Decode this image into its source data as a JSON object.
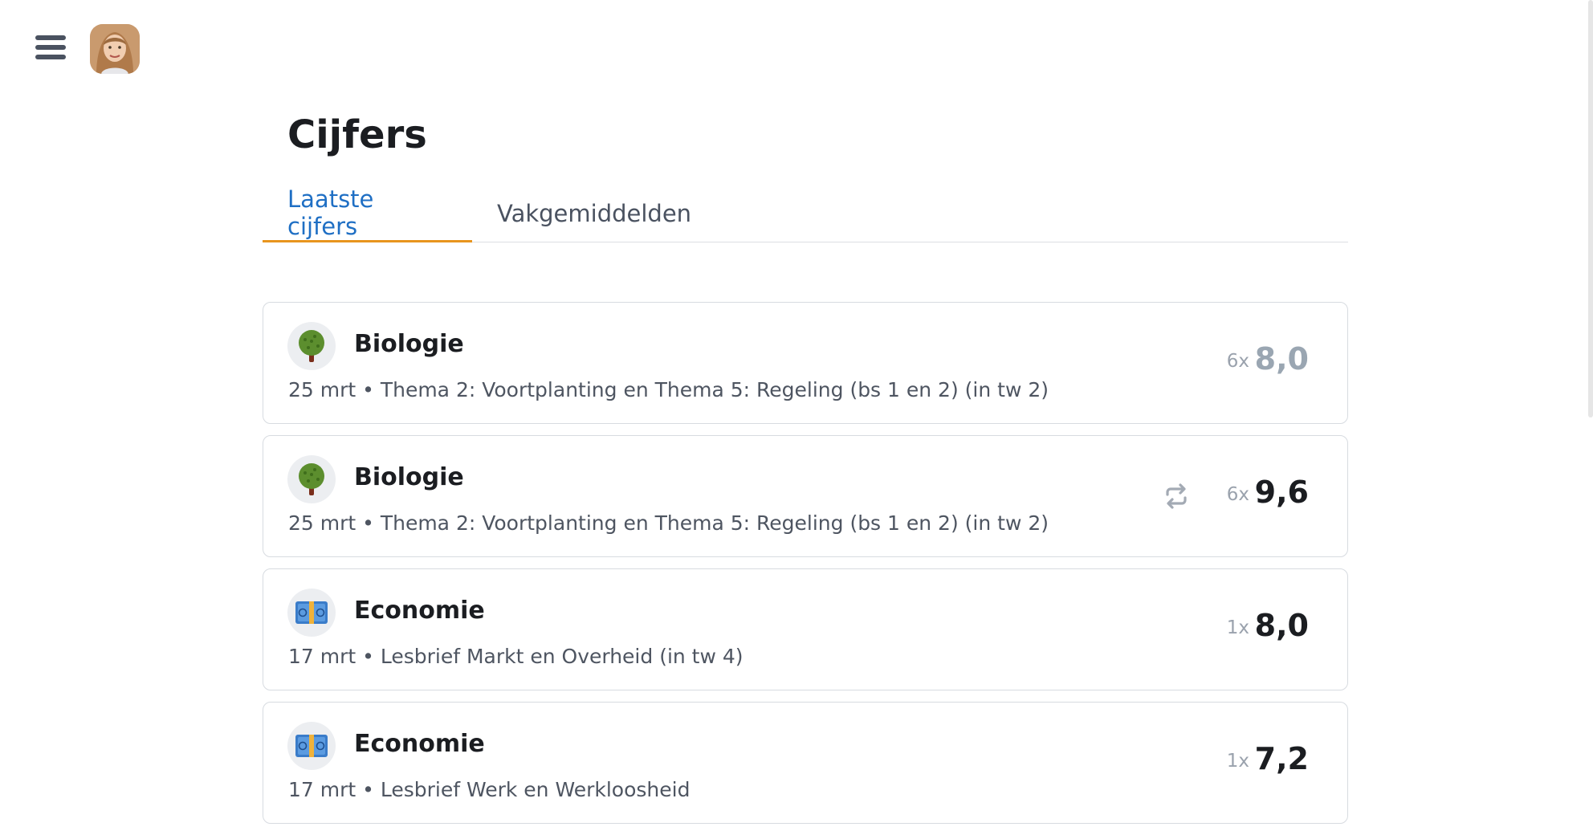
{
  "header": {
    "menu_icon": "hamburger-menu-icon",
    "avatar": "user-avatar"
  },
  "page": {
    "title": "Cijfers"
  },
  "tabs": [
    {
      "label": "Laatste cijfers",
      "active": true
    },
    {
      "label": "Vakgemiddelden",
      "active": false
    }
  ],
  "grades": [
    {
      "subject": "Biologie",
      "icon": "tree-icon",
      "description": "25 mrt • Thema 2: Voortplanting en Thema 5: Regeling (bs 1 en 2) (in tw 2)",
      "weight": "6x",
      "grade": "8,0",
      "dimmed": true,
      "repeat": false
    },
    {
      "subject": "Biologie",
      "icon": "tree-icon",
      "description": "25 mrt • Thema 2: Voortplanting en Thema 5: Regeling (bs 1 en 2) (in tw 2)",
      "weight": "6x",
      "grade": "9,6",
      "dimmed": false,
      "repeat": true
    },
    {
      "subject": "Economie",
      "icon": "euro-banknote-icon",
      "description": "17 mrt • Lesbrief Markt en Overheid (in tw 4)",
      "weight": "1x",
      "grade": "8,0",
      "dimmed": false,
      "repeat": false
    },
    {
      "subject": "Economie",
      "icon": "euro-banknote-icon",
      "description": "17 mrt • Lesbrief Werk en Werkloosheid",
      "weight": "1x",
      "grade": "7,2",
      "dimmed": false,
      "repeat": false
    }
  ],
  "colors": {
    "tab_active_text": "#1f6fc4",
    "tab_active_underline": "#e8951e",
    "grade_dimmed": "#9aa6b2"
  }
}
